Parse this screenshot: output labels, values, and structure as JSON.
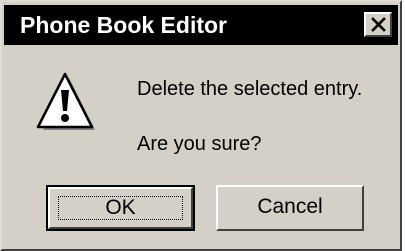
{
  "window": {
    "title": "Phone Book Editor",
    "close_icon": "close-icon"
  },
  "message": {
    "icon": "warning-icon",
    "line1": "Delete the selected entry.",
    "line2": "Are you sure?"
  },
  "buttons": {
    "ok_label": "OK",
    "cancel_label": "Cancel"
  },
  "colors": {
    "face": "#d4d0c8",
    "titlebar": "#000000",
    "title_text": "#ffffff"
  }
}
